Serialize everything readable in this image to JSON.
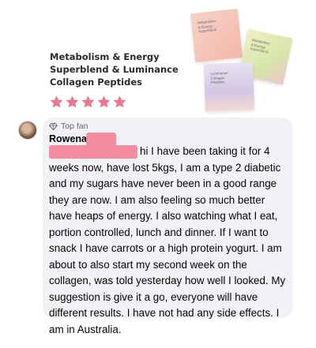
{
  "product": {
    "title": "Metabolism & Energy Superblend & Luminance Collagen Peptides",
    "rating": 5,
    "star_color": "#f0748c",
    "boxes": [
      {
        "label": "Metabolism\n& Energy\nSuperblend"
      },
      {
        "label": "Metabolism\n& Energy\nSuperblend"
      },
      {
        "label": "Luminance\nCollagen\nPeptides"
      }
    ]
  },
  "comment": {
    "badge_icon": "diamond-icon",
    "badge": "Top fan",
    "author": "Rowena",
    "redaction_color": "#f58ca0",
    "text": "hi I have been taking it for 4 weeks now, have lost 5kgs, I am a type 2 diabetic and my sugars have never been in a good range they are now. I am also feeling so much better have heaps of energy. I also watching what I eat, portion controlled, lunch and dinner. If I want to snack I have carrots or a high protein yogurt. I am about to also start my second week on the collagen, was told yesterday how well I looked. My suggestion is give it a go, everyone will have different results. I have not had any side effects. I am in Australia."
  }
}
